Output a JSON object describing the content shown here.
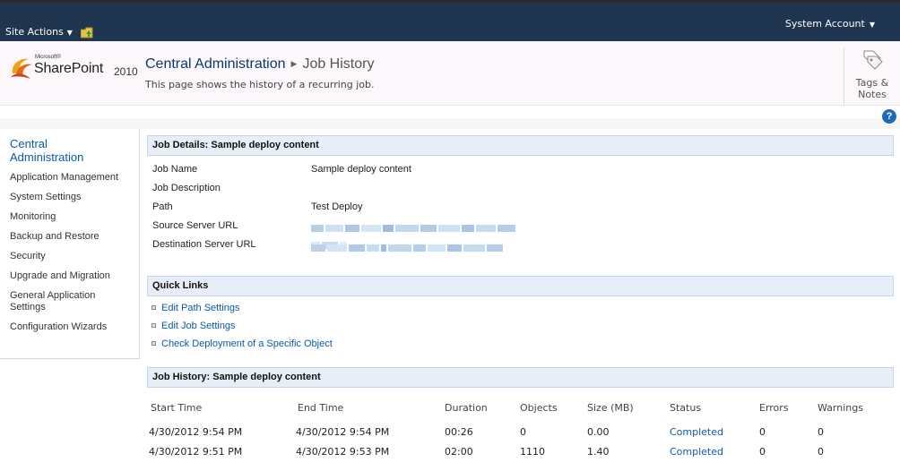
{
  "topbar": {
    "site_actions": "Site Actions",
    "account": "System Account"
  },
  "brand": {
    "microsoft": "Microsoft®",
    "product": "SharePoint",
    "year": "2010"
  },
  "breadcrumb": {
    "root": "Central Administration",
    "current": "Job History"
  },
  "page_description": "This page shows the history of a recurring job.",
  "tags_notes": {
    "line1": "Tags &",
    "line2": "Notes"
  },
  "help_label": "?",
  "leftnav": {
    "heading_line1": "Central",
    "heading_line2": "Administration",
    "items": [
      "Application Management",
      "System Settings",
      "Monitoring",
      "Backup and Restore",
      "Security",
      "Upgrade and Migration",
      "General Application",
      "Settings",
      "Configuration Wizards"
    ]
  },
  "job_details": {
    "title": "Job Details: Sample deploy content",
    "fields": [
      {
        "label": "Job Name",
        "value": "Sample deploy content"
      },
      {
        "label": "Job Description",
        "value": ""
      },
      {
        "label": "Path",
        "value": "Test Deploy"
      },
      {
        "label": "Source Server URL",
        "value": ""
      },
      {
        "label": "Destination Server URL",
        "value": ""
      }
    ]
  },
  "quick_links": {
    "title": "Quick Links",
    "links": [
      "Edit Path Settings",
      "Edit Job Settings",
      "Check Deployment of a Specific Object"
    ]
  },
  "job_history": {
    "title": "Job History: Sample deploy content",
    "columns": [
      "Start Time",
      "End Time",
      "Duration",
      "Objects",
      "Size (MB)",
      "Status",
      "Errors",
      "Warnings"
    ],
    "rows": [
      [
        "4/30/2012 9:54 PM",
        "4/30/2012 9:54 PM",
        "00:26",
        "0",
        "0.00",
        "Completed",
        "0",
        "0"
      ],
      [
        "4/30/2012 9:51 PM",
        "4/30/2012 9:53 PM",
        "02:00",
        "1110",
        "1.40",
        "Completed",
        "0",
        "0"
      ]
    ]
  },
  "colors": {
    "topbar": "#1f3550",
    "link": "#0b5ba8",
    "section_header": "#e8eef7"
  }
}
